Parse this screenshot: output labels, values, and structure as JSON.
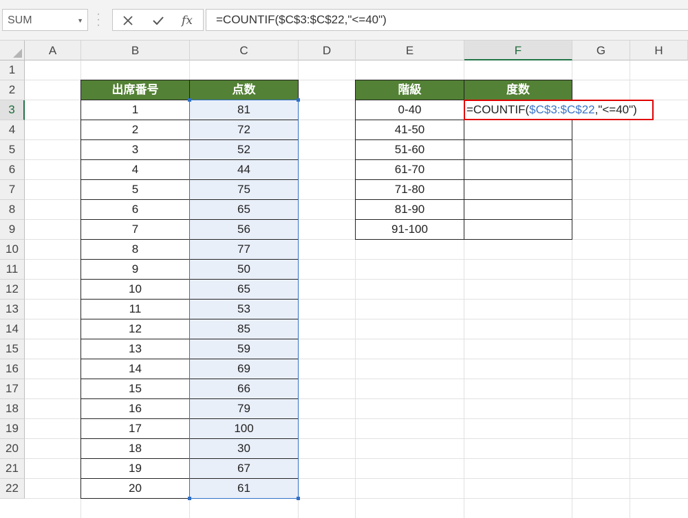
{
  "name_box": {
    "value": "SUM"
  },
  "formula_bar": {
    "text": "=COUNTIF($C$3:$C$22,\"<=40\")",
    "cancel_icon": "x-icon",
    "enter_icon": "check-icon",
    "function_icon": "fx-icon",
    "function_label": "fx"
  },
  "columns": [
    "A",
    "B",
    "C",
    "D",
    "E",
    "F",
    "G",
    "H"
  ],
  "rows": [
    "1",
    "2",
    "3",
    "4",
    "5",
    "6",
    "7",
    "8",
    "9",
    "10",
    "11",
    "12",
    "13",
    "14",
    "15",
    "16",
    "17",
    "18",
    "19",
    "20",
    "21",
    "22"
  ],
  "active": {
    "column": "F",
    "row": "3"
  },
  "table1": {
    "headers": [
      "出席番号",
      "点数"
    ],
    "rows": [
      [
        "1",
        "81"
      ],
      [
        "2",
        "72"
      ],
      [
        "3",
        "52"
      ],
      [
        "4",
        "44"
      ],
      [
        "5",
        "75"
      ],
      [
        "6",
        "65"
      ],
      [
        "7",
        "56"
      ],
      [
        "8",
        "77"
      ],
      [
        "9",
        "50"
      ],
      [
        "10",
        "65"
      ],
      [
        "11",
        "53"
      ],
      [
        "12",
        "85"
      ],
      [
        "13",
        "59"
      ],
      [
        "14",
        "69"
      ],
      [
        "15",
        "66"
      ],
      [
        "16",
        "79"
      ],
      [
        "17",
        "100"
      ],
      [
        "18",
        "30"
      ],
      [
        "19",
        "67"
      ],
      [
        "20",
        "61"
      ]
    ]
  },
  "table2": {
    "headers": [
      "階級",
      "度数"
    ],
    "classes": [
      "0-40",
      "41-50",
      "51-60",
      "61-70",
      "71-80",
      "81-90",
      "91-100"
    ]
  },
  "editing_cell": {
    "prefix": "=COUNTIF(",
    "ref": "$C$3:$C$22",
    "suffix": ",\"<=40\")"
  },
  "colors": {
    "header_fill": "#538135",
    "selection_fill": "#e9eff9",
    "selection_border": "#2f6fc6",
    "edit_highlight": "#e00000",
    "reference_text": "#3b74c8"
  }
}
